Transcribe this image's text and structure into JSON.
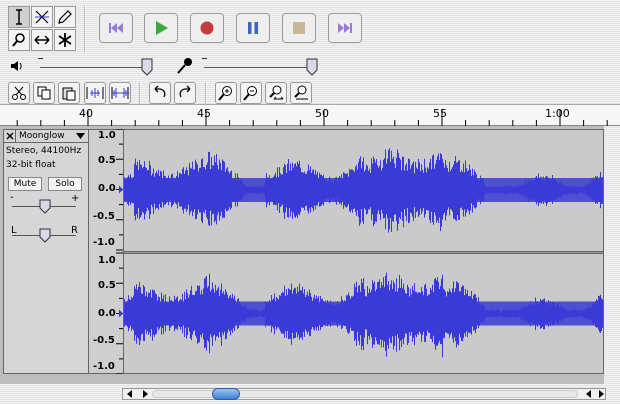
{
  "transport": {
    "skip_start": "Skip to Start",
    "play": "Play",
    "record": "Record",
    "pause": "Pause",
    "stop": "Stop",
    "skip_end": "Skip to End"
  },
  "ruler": {
    "labels": [
      "40",
      "45",
      "50",
      "55",
      "1:00"
    ]
  },
  "track": {
    "name": "Moonglow",
    "format": "Stereo, 44100Hz",
    "bit_depth": "32-bit float",
    "mute_label": "Mute",
    "solo_label": "Solo",
    "gain_minus": "-",
    "gain_plus": "+",
    "pan_left": "L",
    "pan_right": "R"
  },
  "scale": {
    "channel1": [
      "1.0",
      "0.5",
      "0.0",
      "-0.5",
      "-1.0"
    ],
    "channel2": [
      "1.0",
      "0.5",
      "0.0",
      "-0.5",
      "-1.0"
    ]
  },
  "colors": {
    "waveform": "#3a3ad6",
    "track_bg": "#cacaca",
    "record": "#c43b3b",
    "play": "#3aa83a",
    "pause": "#3c62c4",
    "stop": "#c8b89a",
    "skip": "#9a7ad8"
  }
}
